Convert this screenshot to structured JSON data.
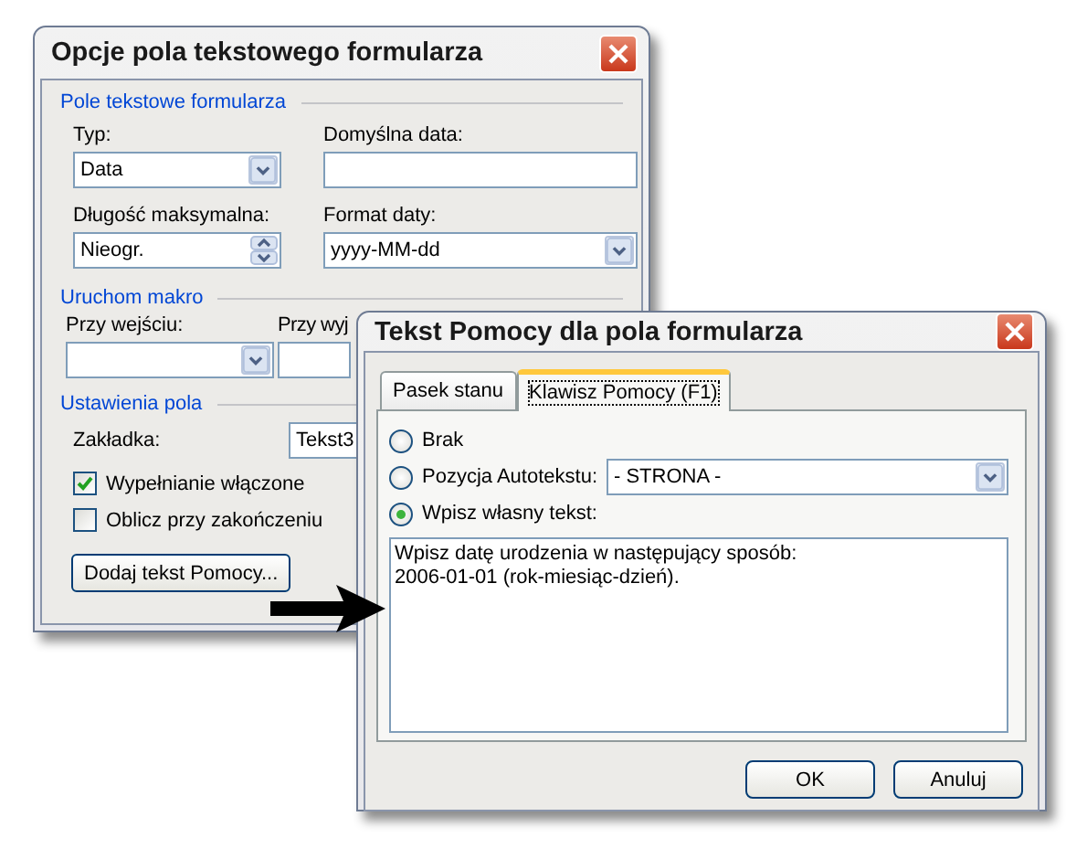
{
  "options_dialog": {
    "title": "Opcje pola tekstowego formularza",
    "field_section": {
      "heading": "Pole tekstowe formularza",
      "type": {
        "label": "Typ:",
        "value": "Data"
      },
      "default_date": {
        "label": "Domyślna data:"
      },
      "max_length": {
        "label": "Długość maksymalna:",
        "value": "Nieogr."
      },
      "date_format": {
        "label": "Format daty:",
        "value": "yyyy-MM-dd"
      }
    },
    "macro_section": {
      "heading": "Uruchom makro",
      "on_entry": {
        "label": "Przy wejściu:"
      },
      "on_exit": {
        "label": "Przy wyj"
      }
    },
    "settings_section": {
      "heading": "Ustawienia pola",
      "bookmark": {
        "label": "Zakładka:",
        "value": "Tekst3"
      },
      "checkboxes": [
        {
          "label": "Wypełnianie włączone",
          "checked": true
        },
        {
          "label": "Oblicz przy zakończeniu",
          "checked": false
        }
      ]
    },
    "help_button": "Dodaj tekst Pomocy..."
  },
  "help_dialog": {
    "title": "Tekst Pomocy dla pola formularza",
    "tabs": [
      {
        "label": "Pasek stanu",
        "selected": false
      },
      {
        "label": "Klawisz Pomocy (F1)",
        "selected": true
      }
    ],
    "options": [
      {
        "label": "Brak",
        "selected": false
      },
      {
        "label": "Pozycja Autotekstu:",
        "selected": false
      },
      {
        "label": "Wpisz własny tekst:",
        "selected": true
      }
    ],
    "autotext": {
      "value": "- STRONA -"
    },
    "custom_text": {
      "value": "Wpisz datę urodzenia w następujący sposób:\n2006-01-01 (rok-miesiąc-dzień)."
    },
    "buttons": [
      "OK",
      "Anuluj"
    ]
  }
}
